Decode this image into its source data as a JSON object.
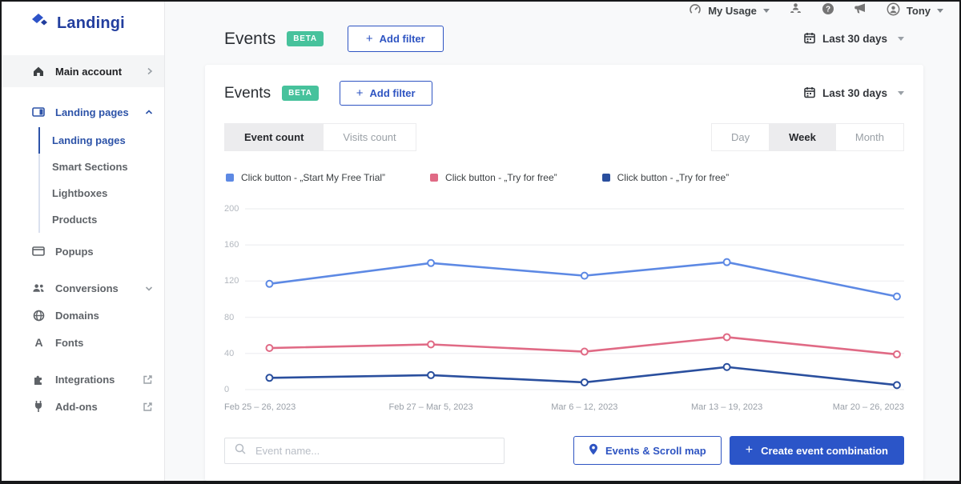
{
  "brand": {
    "name": "Landingi"
  },
  "topbar": {
    "my_usage": "My Usage",
    "username": "Tony"
  },
  "sidebar": {
    "items": [
      {
        "label": "Main account"
      },
      {
        "label": "Landing pages"
      },
      {
        "label": "Landing pages"
      },
      {
        "label": "Smart Sections"
      },
      {
        "label": "Lightboxes"
      },
      {
        "label": "Products"
      },
      {
        "label": "Popups"
      },
      {
        "label": "Conversions"
      },
      {
        "label": "Domains"
      },
      {
        "label": "Fonts"
      },
      {
        "label": "Integrations"
      },
      {
        "label": "Add-ons"
      }
    ]
  },
  "page_header": {
    "title": "Events",
    "beta": "BETA",
    "plus": "+",
    "add_filter": "Add filter",
    "date_range": "Last 30 days"
  },
  "card": {
    "header": {
      "title": "Events",
      "beta": "BETA",
      "plus": "+",
      "add_filter": "Add filter",
      "date_range": "Last 30 days"
    },
    "tabs": [
      {
        "label": "Event count",
        "active": true
      },
      {
        "label": "Visits count",
        "active": false
      }
    ],
    "granularity": [
      {
        "label": "Day",
        "active": false
      },
      {
        "label": "Week",
        "active": true
      },
      {
        "label": "Month",
        "active": false
      }
    ]
  },
  "chart_data": {
    "type": "line",
    "title": "",
    "xlabel": "",
    "ylabel": "",
    "categories": [
      "Feb 25 – 26, 2023",
      "Feb 27 – Mar 5, 2023",
      "Mar 6 – 12, 2023",
      "Mar 13 – 19, 2023",
      "Mar 20 – 26, 2023"
    ],
    "series": [
      {
        "name": "Click button - „Start My Free Trial”",
        "color": "#5d89e4",
        "values": [
          117,
          140,
          126,
          141,
          103
        ]
      },
      {
        "name": "Click button - „Try for free”",
        "color": "#e06a85",
        "values": [
          46,
          50,
          42,
          58,
          39
        ]
      },
      {
        "name": "Click button - „Try for free”",
        "color": "#2a4f9e",
        "values": [
          13,
          16,
          8,
          25,
          5
        ]
      }
    ],
    "ylim": [
      0,
      200
    ],
    "yticks": [
      0,
      40,
      80,
      120,
      160,
      200
    ],
    "grid": true,
    "legend_position": "top-left",
    "marker": "open-circle"
  },
  "footer": {
    "search_placeholder": "Event name...",
    "map_button": "Events & Scroll map",
    "create_plus": "+",
    "create_button": "Create event combination"
  }
}
